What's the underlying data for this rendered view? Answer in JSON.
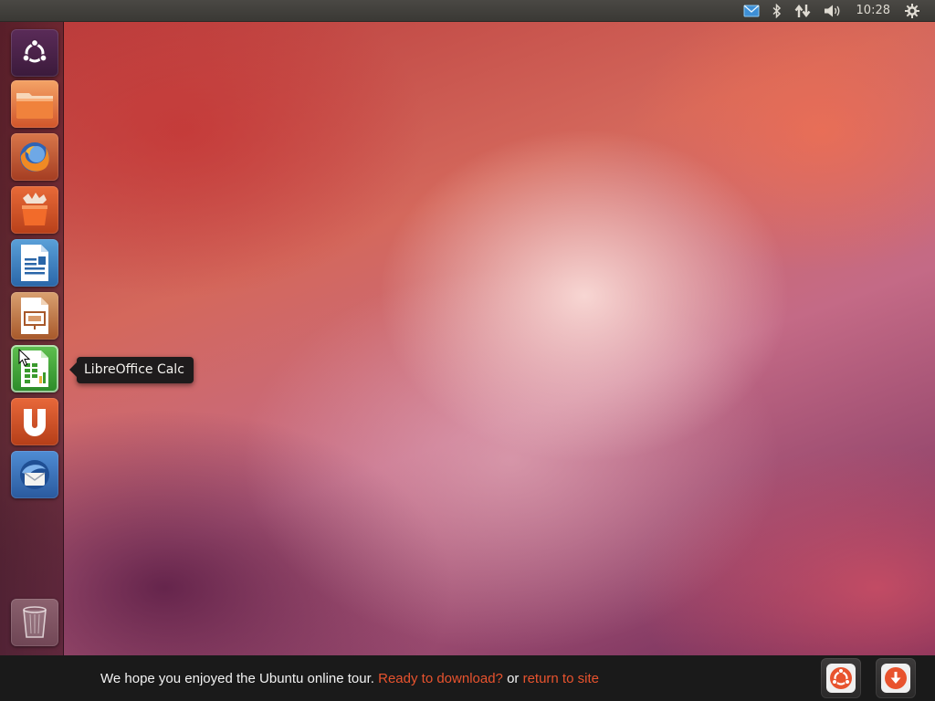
{
  "panel": {
    "indicators": [
      {
        "name": "messaging-icon",
        "color": "#4aa8e8"
      },
      {
        "name": "bluetooth-icon"
      },
      {
        "name": "network-icon"
      },
      {
        "name": "volume-icon"
      }
    ],
    "clock": "10:28",
    "session_icon": "gear-icon"
  },
  "launcher": {
    "items": [
      {
        "name": "dash-home",
        "icon": "ubuntu-logo-icon"
      },
      {
        "name": "home-folder",
        "icon": "folder-icon"
      },
      {
        "name": "firefox",
        "icon": "firefox-icon"
      },
      {
        "name": "ubuntu-software-center",
        "icon": "shopping-bag-icon"
      },
      {
        "name": "libreoffice-writer",
        "icon": "writer-icon"
      },
      {
        "name": "libreoffice-impress",
        "icon": "impress-icon"
      },
      {
        "name": "libreoffice-calc",
        "icon": "calc-icon"
      },
      {
        "name": "ubuntu-one",
        "icon": "ubuntu-one-icon"
      },
      {
        "name": "thunderbird",
        "icon": "thunderbird-icon"
      },
      {
        "name": "trash",
        "icon": "trash-icon"
      }
    ]
  },
  "tooltip": {
    "text": "LibreOffice Calc"
  },
  "bottom_bar": {
    "message": "We hope you enjoyed the Ubuntu online tour.",
    "link_download": "Ready to download?",
    "connector": "or",
    "link_return": "return to site",
    "accent": "#e8532e",
    "buttons": [
      {
        "name": "ubuntu-site-button",
        "icon": "ubuntu-logo-icon"
      },
      {
        "name": "download-button",
        "icon": "download-arrow-icon"
      }
    ]
  }
}
